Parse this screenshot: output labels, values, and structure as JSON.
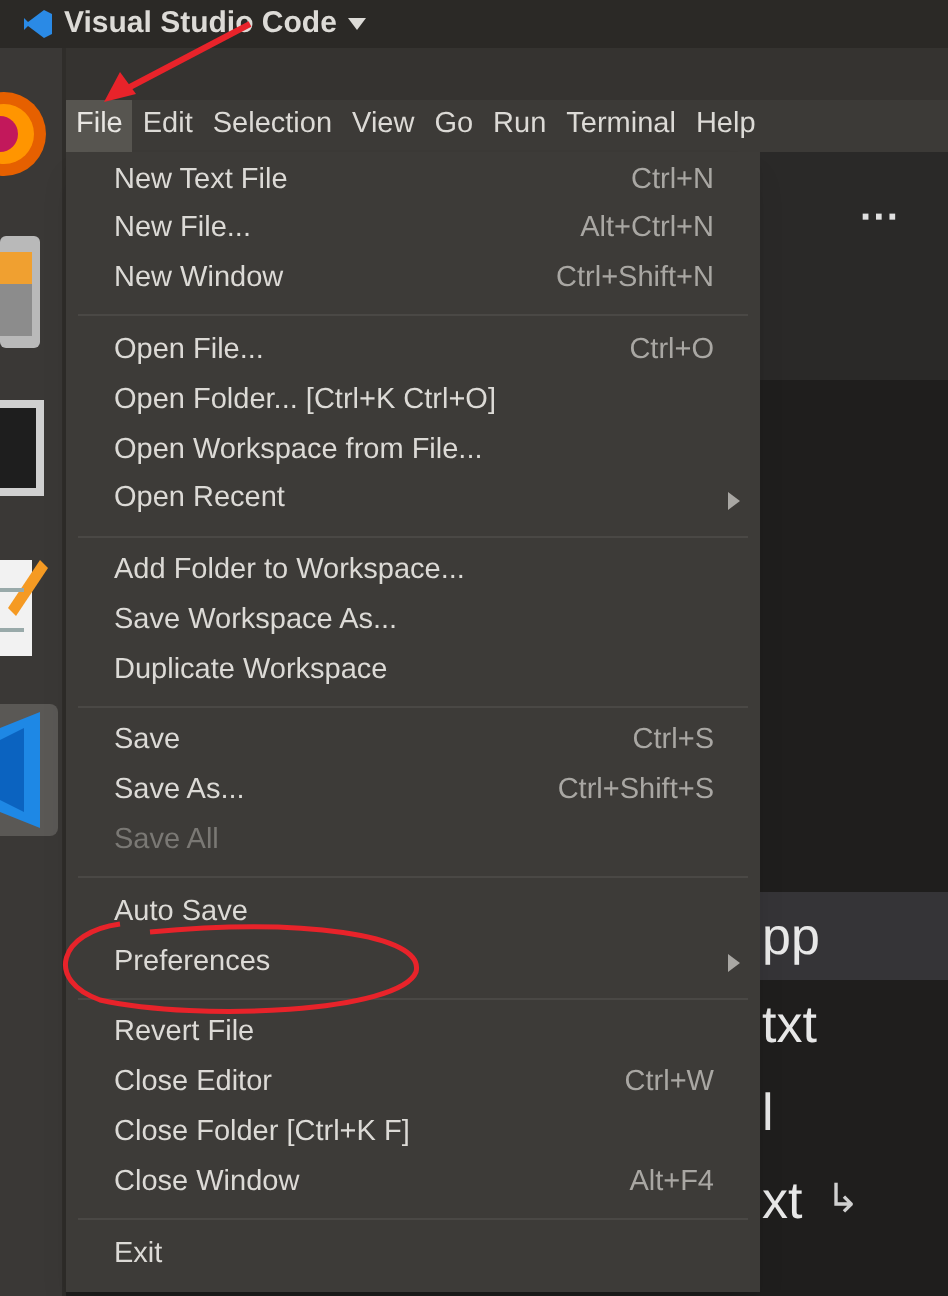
{
  "window": {
    "title": "Visual Studio Code"
  },
  "dock": [
    {
      "kind": "browser",
      "selected": false
    },
    {
      "kind": "files",
      "selected": false
    },
    {
      "kind": "monitor",
      "selected": false
    },
    {
      "kind": "editor",
      "selected": false
    },
    {
      "kind": "vscode",
      "selected": true
    }
  ],
  "menubar": [
    {
      "label": "File",
      "selected": true
    },
    {
      "label": "Edit",
      "selected": false
    },
    {
      "label": "Selection",
      "selected": false
    },
    {
      "label": "View",
      "selected": false
    },
    {
      "label": "Go",
      "selected": false
    },
    {
      "label": "Run",
      "selected": false
    },
    {
      "label": "Terminal",
      "selected": false
    },
    {
      "label": "Help",
      "selected": false
    }
  ],
  "file_menu": [
    [
      {
        "label": "New Text File",
        "shortcut": "Ctrl+N",
        "disabled": false,
        "submenu": false
      },
      {
        "label": "New File...",
        "shortcut": "Alt+Ctrl+N",
        "disabled": false,
        "submenu": false
      },
      {
        "label": "New Window",
        "shortcut": "Ctrl+Shift+N",
        "disabled": false,
        "submenu": false
      }
    ],
    [
      {
        "label": "Open File...",
        "shortcut": "Ctrl+O",
        "disabled": false,
        "submenu": false
      },
      {
        "label": "Open Folder... [Ctrl+K Ctrl+O]",
        "disabled": false,
        "submenu": false
      },
      {
        "label": "Open Workspace from File...",
        "disabled": false,
        "submenu": false
      },
      {
        "label": "Open Recent",
        "disabled": false,
        "submenu": true
      }
    ],
    [
      {
        "label": "Add Folder to Workspace...",
        "disabled": false,
        "submenu": false
      },
      {
        "label": "Save Workspace As...",
        "disabled": false,
        "submenu": false
      },
      {
        "label": "Duplicate Workspace",
        "disabled": false,
        "submenu": false
      }
    ],
    [
      {
        "label": "Save",
        "shortcut": "Ctrl+S",
        "disabled": false,
        "submenu": false
      },
      {
        "label": "Save As...",
        "shortcut": "Ctrl+Shift+S",
        "disabled": false,
        "submenu": false
      },
      {
        "label": "Save All",
        "disabled": true,
        "submenu": false
      }
    ],
    [
      {
        "label": "Auto Save",
        "disabled": false,
        "submenu": false
      },
      {
        "label": "Preferences",
        "disabled": false,
        "submenu": true
      }
    ],
    [
      {
        "label": "Revert File",
        "disabled": false,
        "submenu": false
      },
      {
        "label": "Close Editor",
        "shortcut": "Ctrl+W",
        "disabled": false,
        "submenu": false
      },
      {
        "label": "Close Folder [Ctrl+K F]",
        "disabled": false,
        "submenu": false
      },
      {
        "label": "Close Window",
        "shortcut": "Alt+F4",
        "disabled": false,
        "submenu": false
      }
    ],
    [
      {
        "label": "Exit",
        "disabled": false,
        "submenu": false
      }
    ]
  ],
  "editor": {
    "more": "···",
    "rows": [
      {
        "text": "pp",
        "selected": true
      },
      {
        "text": "txt",
        "selected": false
      },
      {
        "text": "l",
        "selected": false
      },
      {
        "text": "xt",
        "selected": false,
        "arrow": "↳"
      }
    ]
  }
}
